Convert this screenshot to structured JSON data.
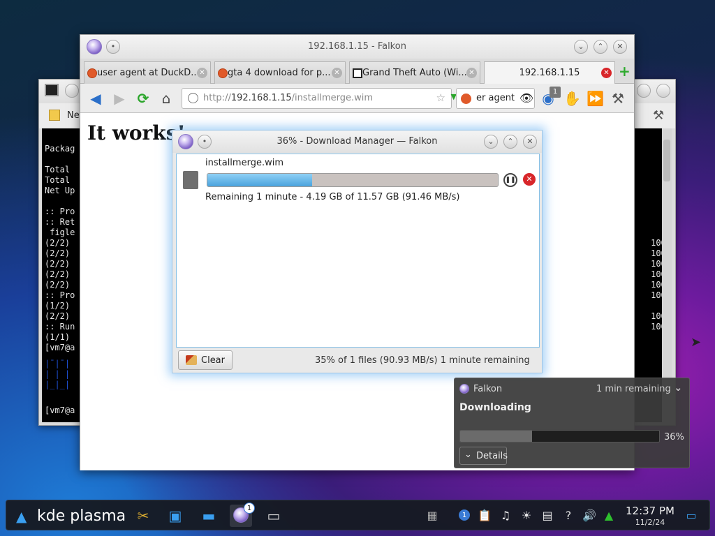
{
  "terminal": {
    "menu_label": "Ne",
    "lines": [
      "",
      "Packag",
      "",
      "Total ",
      "Total ",
      "Net Up",
      "",
      ":: Pro",
      ":: Ret",
      " figle",
      "(2/2) ",
      "(2/2) ",
      "(2/2) ",
      "(2/2) ",
      "(2/2) ",
      ":: Pro",
      "(1/2) ",
      "(2/2) ",
      ":: Run",
      "(1/1) ",
      "[vm7@a"
    ],
    "percents": [
      "100%",
      "100%",
      "100%",
      "100%",
      "100%",
      "100%",
      "100%",
      "100%"
    ],
    "prompt_bottom": "[vm7@a"
  },
  "falkon": {
    "title": "192.168.1.15 - Falkon",
    "tabs": [
      {
        "label": "user agent at DuckD..."
      },
      {
        "label": "gta 4 download for p..."
      },
      {
        "label": "Grand Theft Auto (Wi..."
      },
      {
        "label": "192.168.1.15"
      }
    ],
    "url_scheme": "http://",
    "url_host": "192.168.1.15",
    "url_path": "/installmerge.wim",
    "search_value": "er agent",
    "badge_count": "1",
    "page_heading": "It works!"
  },
  "download_manager": {
    "title": "36% - Download Manager — Falkon",
    "filename": "installmerge.wim",
    "progress": 0.36,
    "remaining_text": "Remaining 1 minute - 4.19 GB of 11.57 GB (91.46 MB/s)",
    "clear_label": "Clear",
    "status_text": "35% of 1 files (90.93 MB/s) 1 minute remaining"
  },
  "notification": {
    "app_name": "Falkon",
    "time_remaining": "1 min remaining",
    "heading": "Downloading",
    "progress": 0.36,
    "percent_label": "36%",
    "details_label": "Details"
  },
  "taskbar": {
    "launcher_label": "kde plasma",
    "falkon_badge": "1",
    "tray_badge": "1",
    "time": "12:37 PM",
    "date": "11/2/24"
  },
  "colors": {
    "progress_fill": "#4aa3dd",
    "cancel_red": "#d8262a",
    "plasma_blue": "#3a7bd5"
  }
}
